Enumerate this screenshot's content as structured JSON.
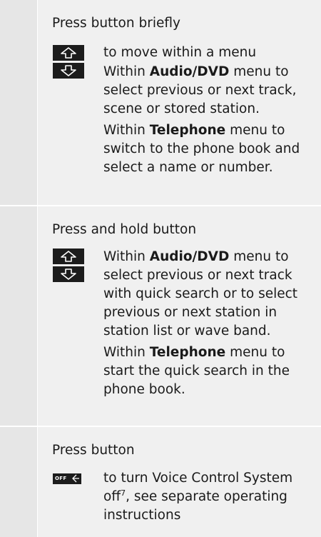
{
  "section1": {
    "heading": "Press button briefly",
    "up_icon": "arrow-up-key-icon",
    "down_icon": "arrow-down-key-icon",
    "lines": [
      {
        "pre": "to move within a menu",
        "bold": "",
        "post": ""
      },
      {
        "pre": "Within ",
        "bold": "Audio/DVD",
        "post": " menu to"
      },
      {
        "pre": "select previous or next track,",
        "bold": "",
        "post": ""
      },
      {
        "pre": "scene or stored station.",
        "bold": "",
        "post": ""
      },
      {
        "pre": "Within ",
        "bold": "Telephone",
        "post": " menu to"
      },
      {
        "pre": "switch to the phone book and",
        "bold": "",
        "post": ""
      },
      {
        "pre": "select a name or number.",
        "bold": "",
        "post": ""
      }
    ]
  },
  "section2": {
    "heading": "Press and hold button",
    "up_icon": "arrow-up-key-icon",
    "down_icon": "arrow-down-key-icon",
    "lines": [
      {
        "pre": "Within ",
        "bold": "Audio/DVD",
        "post": " menu to"
      },
      {
        "pre": "select previous or next track",
        "bold": "",
        "post": ""
      },
      {
        "pre": "with quick search or to select",
        "bold": "",
        "post": ""
      },
      {
        "pre": "previous or next station in",
        "bold": "",
        "post": ""
      },
      {
        "pre": "station list or wave band.",
        "bold": "",
        "post": ""
      },
      {
        "pre": "Within ",
        "bold": "Telephone",
        "post": " menu to"
      },
      {
        "pre": "start the quick search in the",
        "bold": "",
        "post": ""
      },
      {
        "pre": "phone book.",
        "bold": "",
        "post": ""
      }
    ]
  },
  "section3": {
    "heading": "Press button",
    "off_icon": "voice-off-key-icon",
    "off_label": "OFF",
    "lines": [
      {
        "pre": "to turn Voice Control System",
        "bold": "",
        "post": ""
      },
      {
        "pre": "off",
        "sup": "7",
        "post": ", see separate operating"
      },
      {
        "pre": "instructions",
        "bold": "",
        "post": ""
      }
    ]
  }
}
